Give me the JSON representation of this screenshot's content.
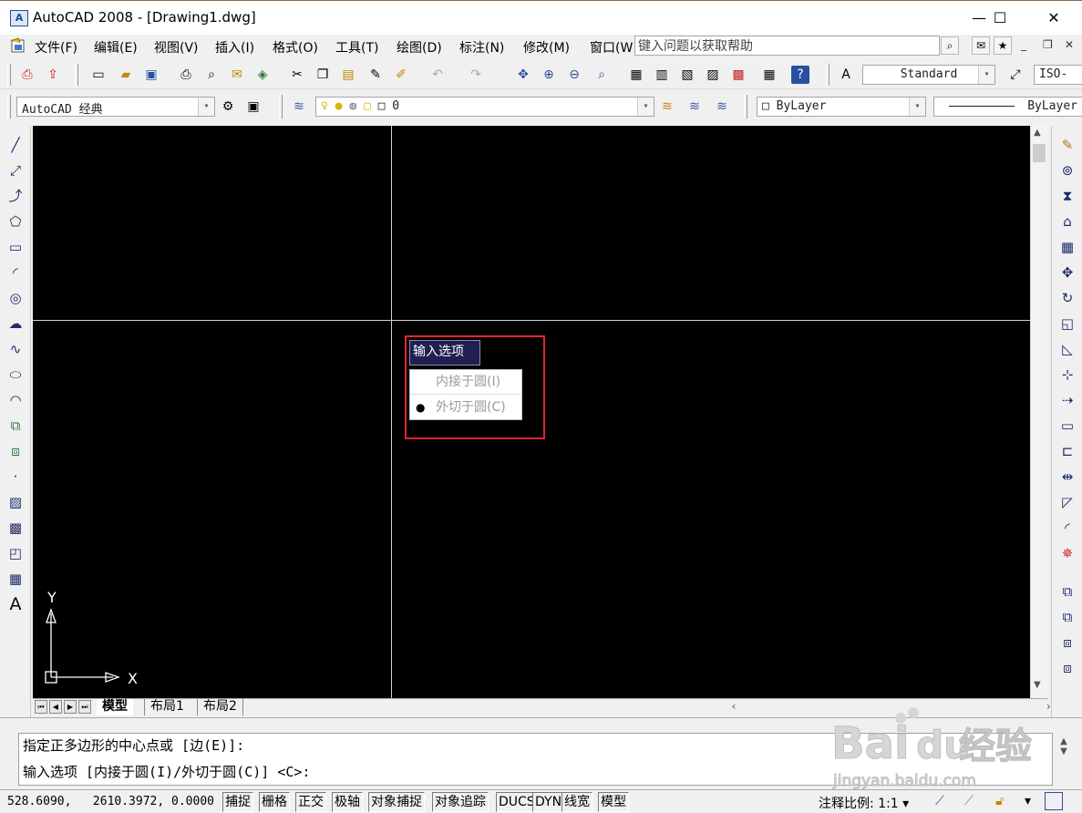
{
  "window": {
    "title": "AutoCAD 2008 - [Drawing1.dwg]",
    "icon_label": "A",
    "controls": {
      "minimize": "—",
      "maximize": "☐",
      "close": "✕"
    }
  },
  "menubar": {
    "items": [
      "文件(F)",
      "编辑(E)",
      "视图(V)",
      "插入(I)",
      "格式(O)",
      "工具(T)",
      "绘图(D)",
      "标注(N)",
      "修改(M)",
      "窗口(W"
    ],
    "help_search": "键入问题以获取帮助",
    "mdi_controls": {
      "minimize": "_",
      "restore": "❐",
      "close": "✕"
    }
  },
  "toolbar1": {
    "text_style": "Standard",
    "dim_style": "ISO-"
  },
  "toolbar2": {
    "workspace": "AutoCAD 经典",
    "layer": "0",
    "color": "ByLayer",
    "linetype": "ByLayer"
  },
  "canvas": {
    "ucs_x": "X",
    "ucs_y": "Y"
  },
  "dyn_prompt": {
    "title": "输入选项",
    "options": [
      {
        "label": "内接于圆(I)",
        "selected": false
      },
      {
        "label": "外切于圆(C)",
        "selected": true
      }
    ],
    "bullet": "●",
    "highlight_color": "#e0252f"
  },
  "layout_tabs": {
    "tabs": [
      "模型",
      "布局1",
      "布局2"
    ],
    "active": "模型"
  },
  "command": {
    "line1": "指定正多边形的中心点或 [边(E)]:",
    "line2": "输入选项 [内接于圆(I)/外切于圆(C)] <C>:"
  },
  "status": {
    "coords": "528.6090,   2610.3972, 0.0000",
    "toggles": [
      "捕捉",
      "栅格",
      "正交",
      "极轴",
      "对象捕捉",
      "对象追踪",
      "DUCS",
      "DYN",
      "线宽",
      "模型"
    ],
    "annotation_scale_label": "注释比例:",
    "annotation_scale": "1:1"
  },
  "watermark": {
    "line1": "Bai",
    "line2": "du",
    "line3": "经验",
    "url": "jingyan.baidu.com"
  }
}
